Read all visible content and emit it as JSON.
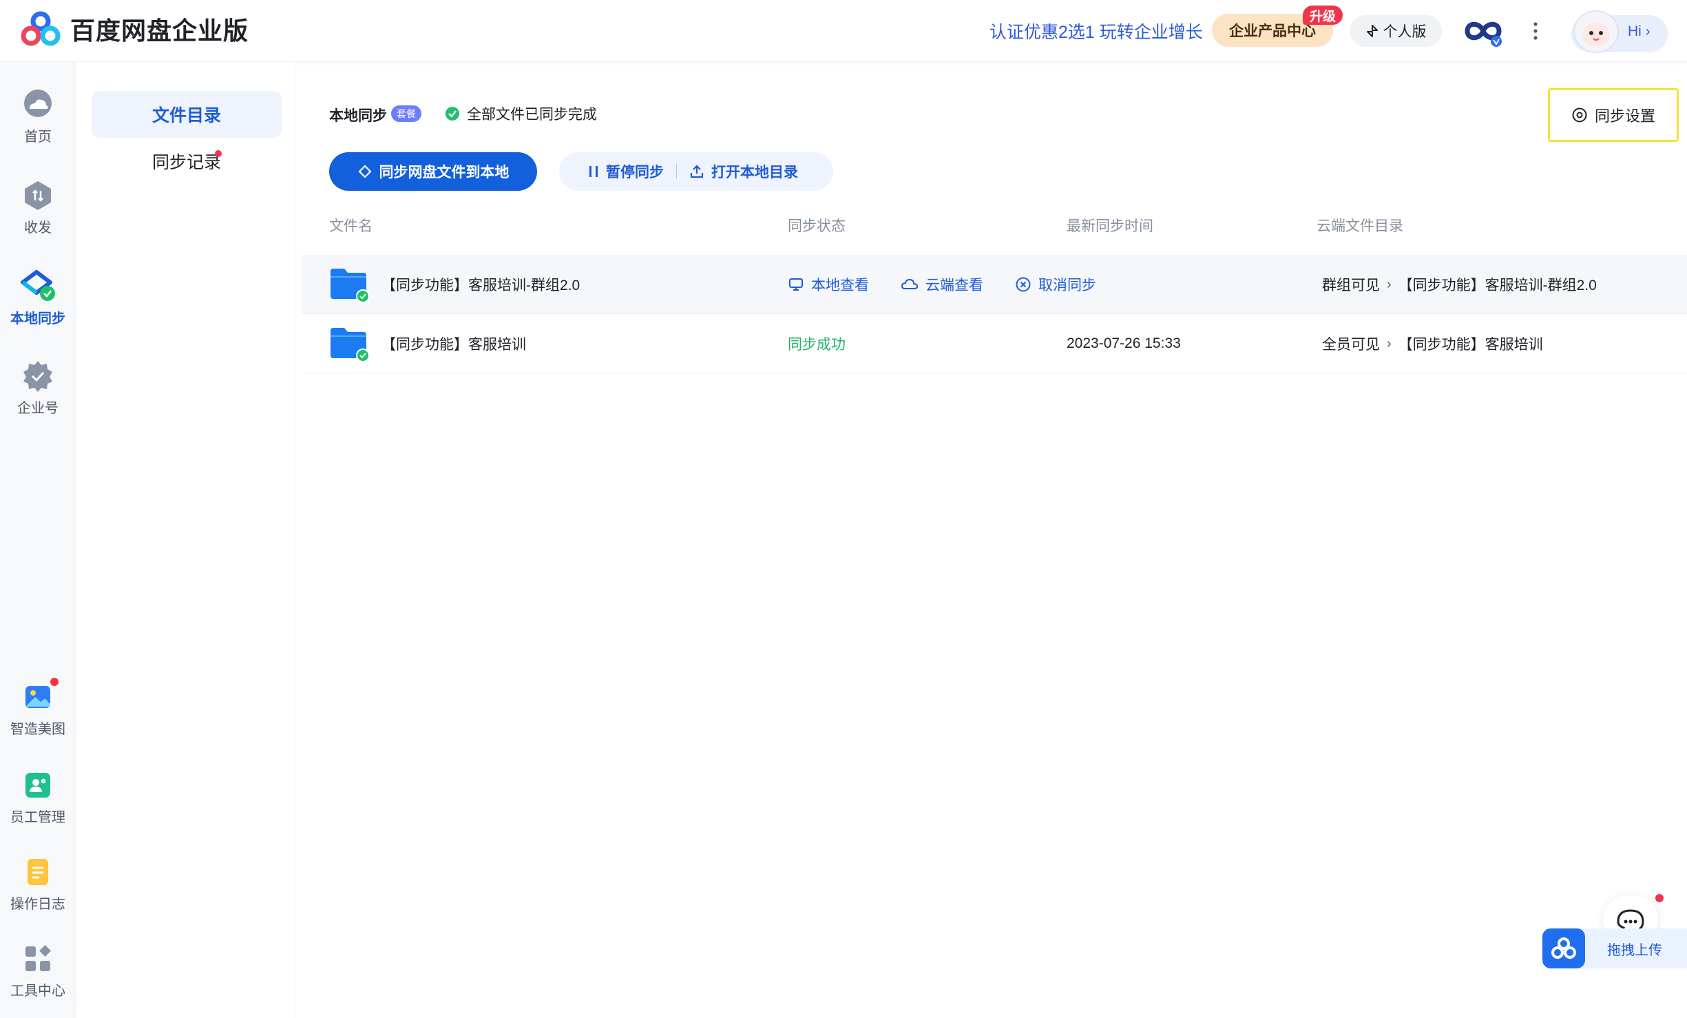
{
  "brand": {
    "name": "百度网盘企业版"
  },
  "header": {
    "promo": "认证优惠2选1 玩转企业增长",
    "enterprise_center": "企业产品中心",
    "upgrade_badge": "升级",
    "personal": "个人版",
    "hi": "Hi"
  },
  "rail": {
    "items": [
      {
        "label": "首页",
        "icon": "cloud-home-icon"
      },
      {
        "label": "收发",
        "icon": "transfer-icon"
      },
      {
        "label": "本地同步",
        "icon": "local-sync-icon",
        "active": true
      },
      {
        "label": "企业号",
        "icon": "enterprise-badge-icon"
      }
    ],
    "bottom_items": [
      {
        "label": "智造美图",
        "icon": "image-ai-icon"
      },
      {
        "label": "员工管理",
        "icon": "staff-icon"
      },
      {
        "label": "操作日志",
        "icon": "log-icon"
      },
      {
        "label": "工具中心",
        "icon": "tools-icon"
      }
    ]
  },
  "subnav": {
    "items": [
      {
        "label": "文件目录",
        "active": true
      },
      {
        "label": "同步记录"
      }
    ]
  },
  "main": {
    "title": "本地同步",
    "tag": "套餐",
    "status": "全部文件已同步完成",
    "sync_setting": "同步设置",
    "btn_sync_download": "同步网盘文件到本地",
    "btn_pause": "暂停同步",
    "btn_open_local": "打开本地目录",
    "columns": [
      "文件名",
      "同步状态",
      "最新同步时间",
      "云端文件目录"
    ],
    "rows": [
      {
        "name": "【同步功能】客服培训-群组2.0",
        "actions": [
          "本地查看",
          "云端查看",
          "取消同步"
        ],
        "time": "",
        "cloud_scope": "群组可见",
        "cloud_folder": "【同步功能】客服培训-群组2.0"
      },
      {
        "name": "【同步功能】客服培训",
        "status": "同步成功",
        "time": "2023-07-26 15:33",
        "cloud_scope": "全员可见",
        "cloud_folder": "【同步功能】客服培训"
      }
    ]
  },
  "floating": {
    "upload": "拖拽上传"
  },
  "colors": {
    "primary": "#1360dc",
    "link": "#1f5cd6",
    "success": "#20b368",
    "highlight_border": "#f4e23a",
    "badge_red": "#f2344b"
  }
}
